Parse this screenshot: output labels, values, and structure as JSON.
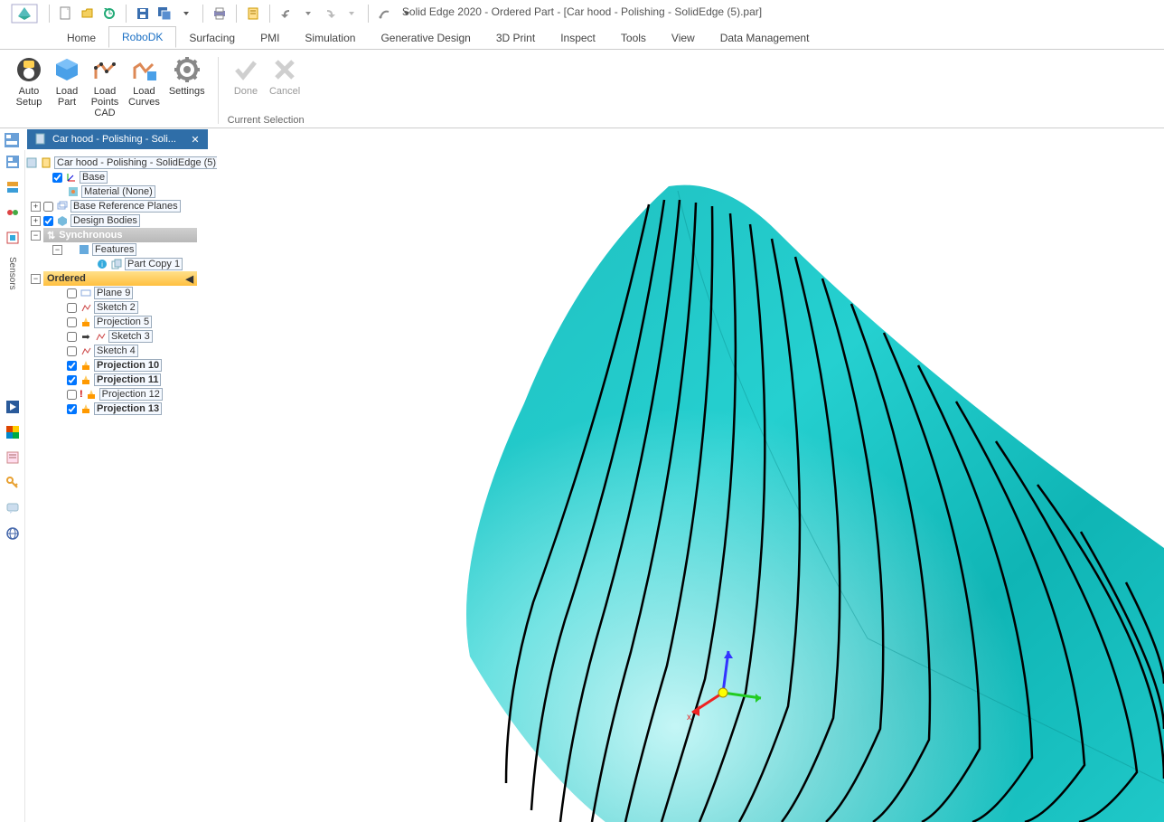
{
  "title": "Solid Edge 2020 - Ordered Part - [Car hood - Polishing - SolidEdge (5).par]",
  "tabs": [
    "Home",
    "RoboDK",
    "Surfacing",
    "PMI",
    "Simulation",
    "Generative Design",
    "3D Print",
    "Inspect",
    "Tools",
    "View",
    "Data Management"
  ],
  "active_tab": "RoboDK",
  "ribbon": {
    "auto_setup": "Auto\nSetup",
    "load_part": "Load\nPart",
    "load_points": "Load\nPoints\nCAD",
    "load_curves": "Load\nCurves",
    "settings": "Settings",
    "done": "Done",
    "cancel": "Cancel",
    "group_label": "Current Selection"
  },
  "doc_tab": "Car hood - Polishing - Soli...",
  "sensors_label": "Sensors",
  "tree": {
    "root": "Car hood - Polishing - SolidEdge (5).par",
    "base": "Base",
    "material": "Material (None)",
    "base_ref_planes": "Base Reference Planes",
    "design_bodies": "Design Bodies",
    "synchronous": "Synchronous",
    "features": "Features",
    "part_copy": "Part Copy 1",
    "ordered": "Ordered",
    "plane9": "Plane 9",
    "sketch2": "Sketch 2",
    "projection5": "Projection 5",
    "sketch3": "Sketch 3",
    "sketch4": "Sketch 4",
    "projection10": "Projection 10",
    "projection11": "Projection 11",
    "projection12": "Projection 12",
    "projection13": "Projection 13"
  }
}
